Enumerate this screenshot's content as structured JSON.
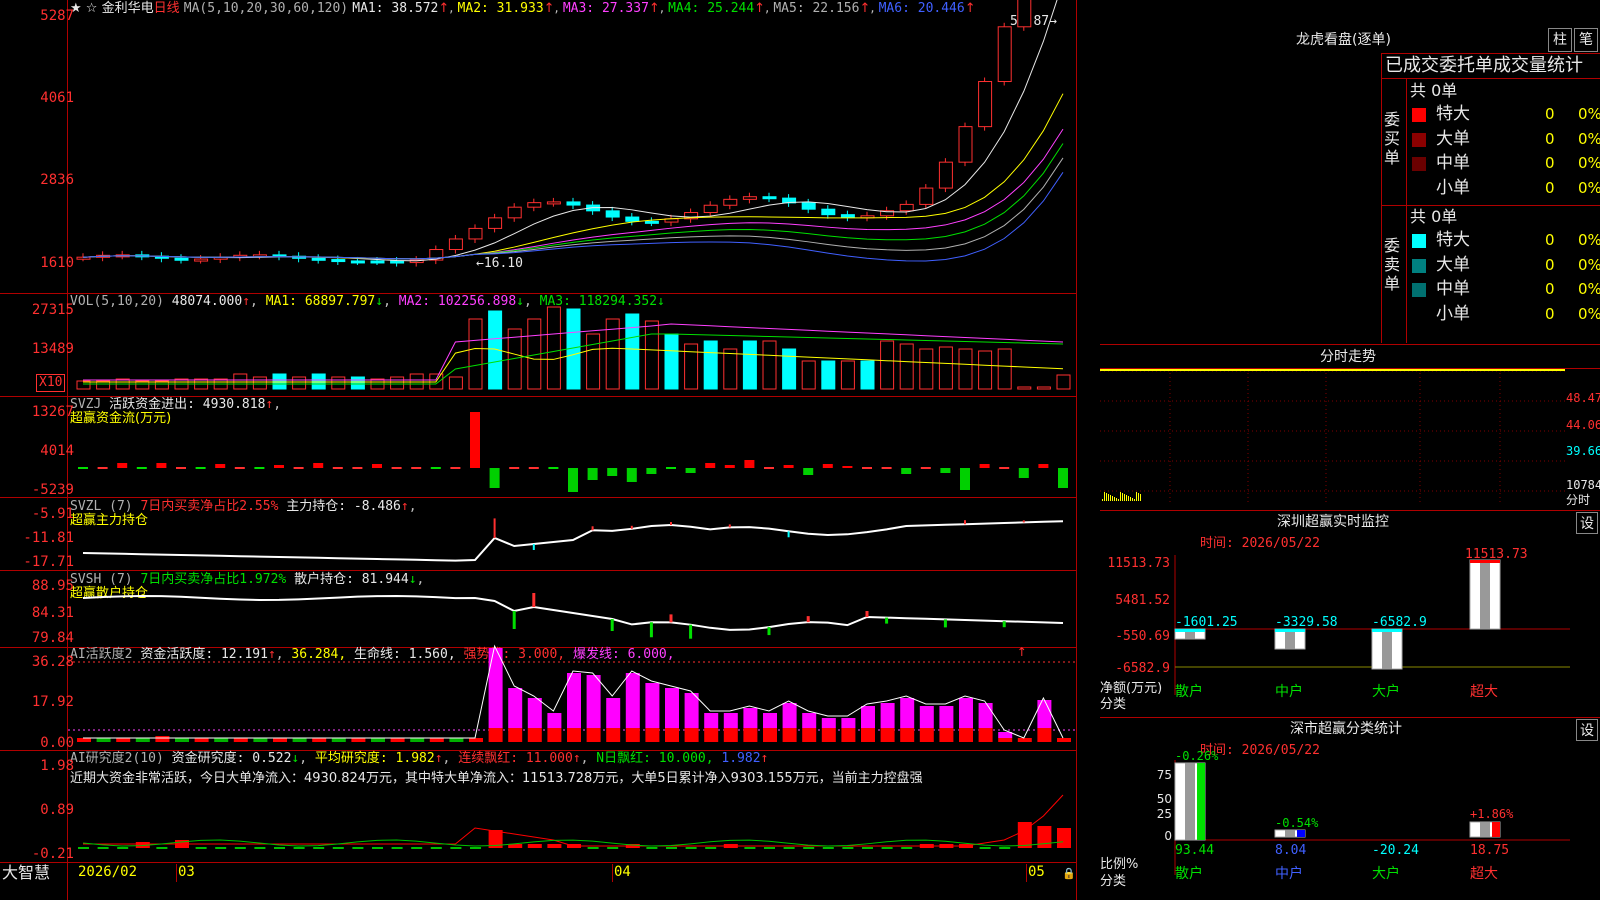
{
  "stock": {
    "star": "★ ☆",
    "name": "金利华电",
    "period": "日线"
  },
  "main": {
    "ma_title": "MA(5,10,20,30,60,120)",
    "ma1": "MA1: 38.572",
    "ma2": "MA2: 31.933",
    "ma3": "MA3: 27.337",
    "ma4": "MA4: 25.244",
    "ma5": "MA5: 22.156",
    "ma6": "MA6: 20.446",
    "y_labels": [
      "5287",
      "4061",
      "2836",
      "1610"
    ],
    "high_label": "52.87",
    "low_label": "16.10"
  },
  "vol": {
    "title": "VOL(5,10,20)",
    "value": "48074.000",
    "ma1": "MA1: 68897.797",
    "ma2": "MA2: 102256.898",
    "ma3": "MA3: 118294.352",
    "y_labels": [
      "27315",
      "13489"
    ],
    "unit": "X10"
  },
  "svzj": {
    "title": "SVZJ",
    "label": "活跃资金进出: 4930.818",
    "sub": "超赢资金流(万元)",
    "y_labels": [
      "13267",
      "4014",
      "-5239"
    ]
  },
  "svzl": {
    "title": "SVZL (7)",
    "pct": "7日内买卖净占比2.55%",
    "label": "主力持仓: -8.486",
    "sub": "超赢主力持仓",
    "y_labels": [
      "-5.91",
      "-11.81",
      "-17.71"
    ]
  },
  "svsh": {
    "title": "SVSH (7)",
    "pct": "7日内买卖净占比1.972%",
    "label": "散户持仓: 81.944",
    "sub": "超赢散户持仓",
    "y_labels": [
      "88.95",
      "84.31",
      "79.84"
    ]
  },
  "ai1": {
    "title": "AI活跃度2",
    "l1": "资金活跃度: 12.191",
    "l2": "36.284,",
    "l3": "生命线: 1.560,",
    "l4": "强势线: 3.000,",
    "l5": "爆发线: 6.000,",
    "y_labels": [
      "36.28",
      "17.92",
      "0.00"
    ]
  },
  "ai2": {
    "title": "AI研究度2(10)",
    "l1": "资金研究度: 0.522",
    "l2": "平均研究度: 1.982",
    "l3": "连续飘红: 11.000",
    "l4": "N日飘红: 10.000,",
    "l5": "1.982",
    "y_labels": [
      "1.98",
      "0.89",
      "-0.21"
    ],
    "note": "近期大资金非常活跃，今日大单净流入：4930.824万元，其中特大单净流入：11513.728万元，大单5日累计净入9303.155万元，当前主力控盘强"
  },
  "bottom": {
    "brand": "大智慧",
    "dates": [
      "2026/02",
      "03",
      "04",
      "05"
    ]
  },
  "right": {
    "lhb_title": "龙虎看盘(逐单)",
    "btn_bar": "柱",
    "btn_pen": "笔",
    "stat_title": "已成交委托单成交量统计",
    "buy_label": "委买单",
    "sell_label": "委卖单",
    "buy_total": "共 0单",
    "sell_total": "共 0单",
    "buy_rows": [
      {
        "name": "特大",
        "val": "0",
        "pct": "0%",
        "color": "#ff0000"
      },
      {
        "name": "大单",
        "val": "0",
        "pct": "0%",
        "color": "#8b0000"
      },
      {
        "name": "中单",
        "val": "0",
        "pct": "0%",
        "color": "#6a0000"
      },
      {
        "name": "小单",
        "val": "0",
        "pct": "0%",
        "color": ""
      }
    ],
    "sell_rows": [
      {
        "name": "特大",
        "val": "0",
        "pct": "0%",
        "color": "#00ffff"
      },
      {
        "name": "大单",
        "val": "0",
        "pct": "0%",
        "color": "#008080"
      },
      {
        "name": "中单",
        "val": "0",
        "pct": "0%",
        "color": "#007070"
      },
      {
        "name": "小单",
        "val": "0",
        "pct": "0%",
        "color": ""
      }
    ],
    "fs_title": "分时走势",
    "fs_labels": [
      "48.47",
      "44.06",
      "39.66",
      "10784"
    ],
    "fs_unit": "分时",
    "mon_title": "深圳超赢实时监控",
    "mon_btn": "设",
    "mon_time": "时间: 2026/05/22",
    "mon_y": [
      "11513.73",
      "5481.52",
      "-550.69",
      "-6582.9"
    ],
    "mon_vals": [
      "-1601.25",
      "-3329.58",
      "-6582.9",
      "11513.73"
    ],
    "mon_top": "11513.73",
    "mon_axis": "净额(万元)",
    "mon_axis2": "分类",
    "cats": [
      "散户",
      "中户",
      "大户",
      "超大"
    ],
    "cls_title": "深市超赢分类统计",
    "cls_btn": "设",
    "cls_time": "时间: 2026/05/22",
    "cls_pcts": [
      "-0.26%",
      "-0.54%",
      "+1.86%"
    ],
    "cls_y": [
      "75",
      "50",
      "25",
      "0"
    ],
    "cls_vals": [
      "93.44",
      "8.04",
      "-20.24",
      "18.75"
    ],
    "cls_axis": "比例%",
    "cls_axis2": "分类"
  }
}
